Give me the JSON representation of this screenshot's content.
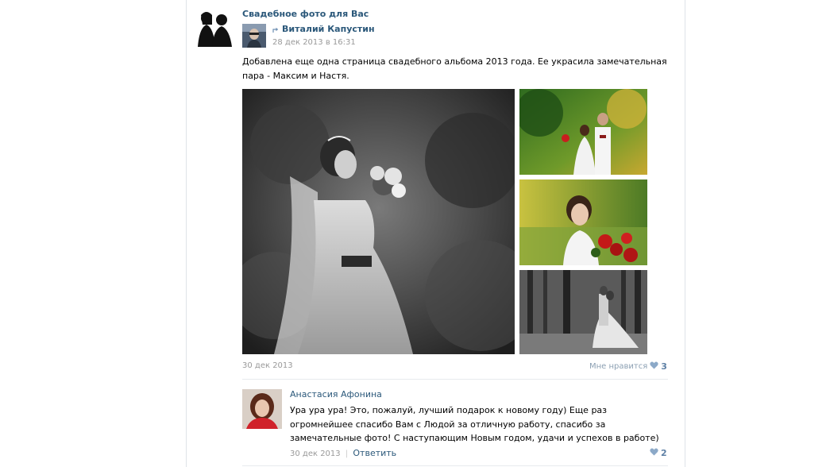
{
  "post": {
    "group_name": "Свадебное фото для Вас",
    "reposted_from": "Виталий Капустин",
    "date": "28 дек 2013 в 16:31",
    "text": "Добавлена еще одна страница свадебного альбома 2013 года. Ее украсила замечательная пара - Максим и Настя.",
    "footer_date": "30 дек 2013",
    "like_label": "Мне нравится",
    "like_count": "3"
  },
  "comment": {
    "author": "Анастасия Афонина",
    "text": "Ура ура ура! Это, пожалуй, лучший подарок к новому году) Еще раз огромнейшее спасибо Вам с Людой за отличную работу, спасибо за замечательные фото! С наступающим Новым годом, удачи и успехов в работе)",
    "date": "30 дек 2013",
    "separator": "|",
    "reply_label": "Ответить",
    "like_count": "2"
  },
  "icons": {
    "repost": "repost-arrow-icon",
    "heart": "heart-icon"
  },
  "colors": {
    "link": "#2b587a",
    "muted": "#999999",
    "heart": "#5e80a5"
  }
}
